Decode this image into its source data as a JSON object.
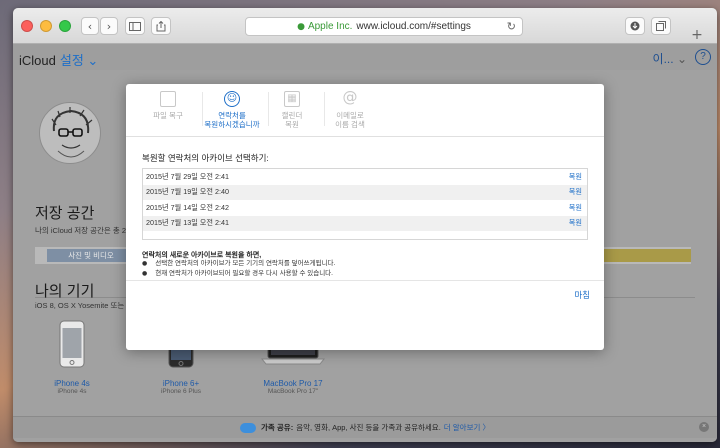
{
  "browser": {
    "address_org": "Apple Inc.",
    "address_url": "www.icloud.com/#settings",
    "new_tab_label": "+"
  },
  "app": {
    "brand": "iCloud",
    "settings_label": "설정",
    "user_menu": "이...",
    "help_label": "?"
  },
  "storage": {
    "title": "저장 공간",
    "subtitle": "나의 iCloud 저장 공간은 총 20GB",
    "segment_label": "사진 및 비디오"
  },
  "devices": {
    "title": "나의 기기",
    "subtitle": "iOS 8, OS X Yosemite 또는 wa",
    "items": [
      {
        "name": "iPhone 4s",
        "model": "iPhone 4s"
      },
      {
        "name": "iPhone 6+",
        "model": "iPhone 6 Plus"
      },
      {
        "name": "MacBook Pro 17",
        "model": "MacBook Pro 17\""
      }
    ]
  },
  "footer": {
    "bold": "가족 공유:",
    "text": "음악, 영화, App, 사진 등을 가족과 공유하세요.",
    "link": "더 알아보기 〉"
  },
  "modal": {
    "tabs": [
      {
        "line1": "파일 복구",
        "line2": "",
        "icon": "document-icon",
        "active": false
      },
      {
        "line1": "연락처를",
        "line2": "복원하시겠습니까",
        "icon": "contacts-icon",
        "active": true
      },
      {
        "line1": "캘린더",
        "line2": "복원",
        "icon": "calendar-icon",
        "active": false
      },
      {
        "line1": "이메일로",
        "line2": "이름 검색",
        "icon": "at-icon",
        "active": false
      }
    ],
    "heading": "복원할 연락처의 아카이브 선택하기:",
    "archives": [
      {
        "date": "2015년 7월 29일 오전 2:41",
        "action": "복원"
      },
      {
        "date": "2015년 7월 19일 오전 2:40",
        "action": "복원"
      },
      {
        "date": "2015년 7월 14일 오전 2:42",
        "action": "복원"
      },
      {
        "date": "2015년 7월 13일 오전 2:41",
        "action": "복원"
      }
    ],
    "note_title": "연락처의 새로운 아카이브로 복원을 하면,",
    "notes": [
      "선택한 연락처의 아카이브가 모든 기기의 연락처를 덮어쓰게됩니다.",
      "현재 연락처가 아카이브되어 필요할 경우 다시 사용할 수 있습니다."
    ],
    "done_label": "마침"
  },
  "colors": {
    "accent": "#1e6fc8",
    "secure": "#3a9a38"
  }
}
